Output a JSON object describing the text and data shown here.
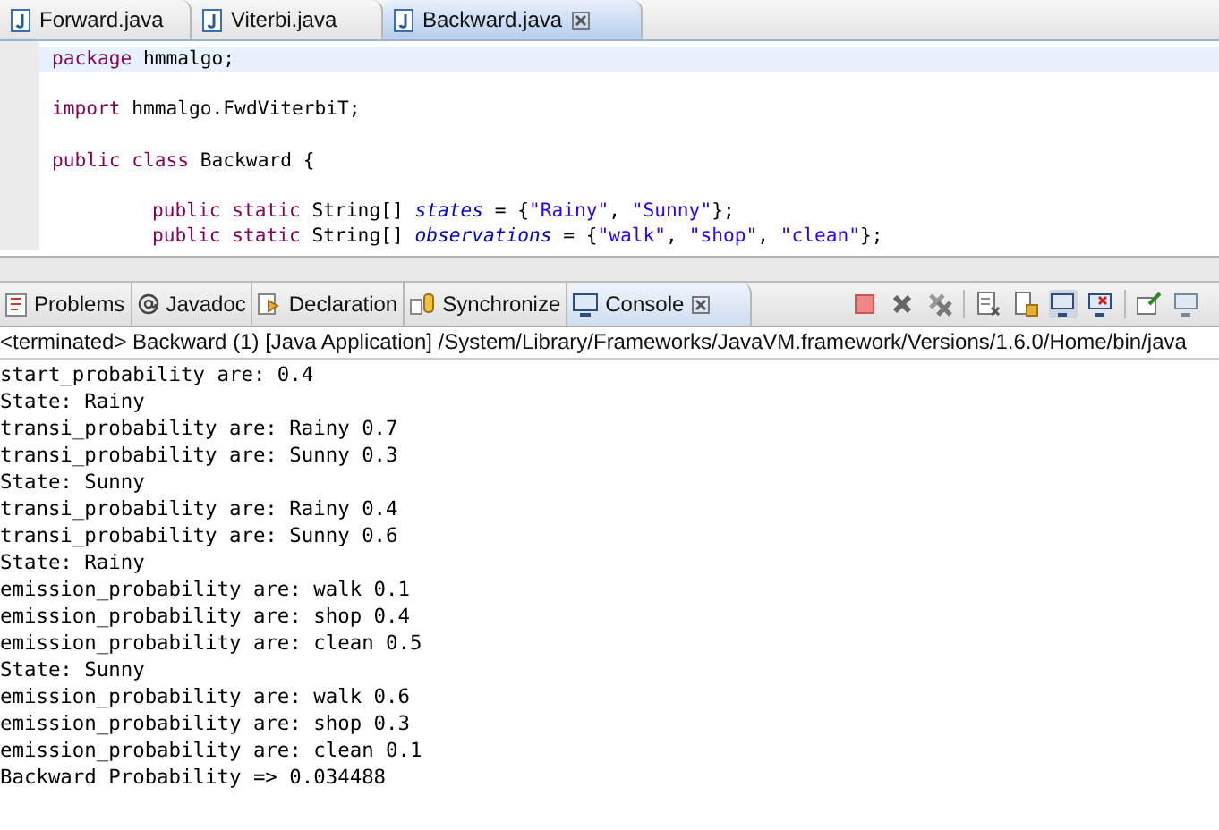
{
  "editor": {
    "tabs": [
      {
        "label": "Forward.java",
        "selected": false
      },
      {
        "label": "Viterbi.java",
        "selected": false
      },
      {
        "label": "Backward.java",
        "selected": true
      }
    ],
    "lines": [
      {
        "kind": "top",
        "tokens": [
          {
            "kind": "keyword",
            "text": "package"
          },
          {
            "kind": "plain",
            "text": " hmmalgo;"
          }
        ]
      },
      {
        "kind": "blank"
      },
      {
        "kind": "top",
        "tokens": [
          {
            "kind": "keyword",
            "text": "import"
          },
          {
            "kind": "plain",
            "text": " hmmalgo.FwdViterbiT;"
          }
        ]
      },
      {
        "kind": "blank"
      },
      {
        "kind": "top",
        "tokens": [
          {
            "kind": "keyword",
            "text": "public class"
          },
          {
            "kind": "plain",
            "text": " Backward {"
          }
        ]
      },
      {
        "kind": "blank"
      },
      {
        "kind": "member",
        "tokens": [
          {
            "kind": "keyword",
            "text": "public static"
          },
          {
            "kind": "plain",
            "text": " String[] "
          },
          {
            "kind": "field",
            "text": "states"
          },
          {
            "kind": "plain",
            "text": " = {"
          },
          {
            "kind": "string",
            "text": "\"Rainy\""
          },
          {
            "kind": "plain",
            "text": ", "
          },
          {
            "kind": "string",
            "text": "\"Sunny\""
          },
          {
            "kind": "plain",
            "text": "};"
          }
        ]
      },
      {
        "kind": "member",
        "tokens": [
          {
            "kind": "keyword",
            "text": "public static"
          },
          {
            "kind": "plain",
            "text": " String[] "
          },
          {
            "kind": "field",
            "text": "observations"
          },
          {
            "kind": "plain",
            "text": " = {"
          },
          {
            "kind": "string",
            "text": "\"walk\""
          },
          {
            "kind": "plain",
            "text": ", "
          },
          {
            "kind": "string",
            "text": "\"shop\""
          },
          {
            "kind": "plain",
            "text": ", "
          },
          {
            "kind": "string",
            "text": "\"clean\""
          },
          {
            "kind": "plain",
            "text": "};"
          }
        ]
      }
    ]
  },
  "views": {
    "tabs": [
      {
        "label": "Problems",
        "selected": false
      },
      {
        "label": "Javadoc",
        "selected": false
      },
      {
        "label": "Declaration",
        "selected": false
      },
      {
        "label": "Synchronize",
        "selected": false
      },
      {
        "label": "Console",
        "selected": true
      }
    ]
  },
  "console": {
    "header": "<terminated> Backward (1) [Java Application] /System/Library/Frameworks/JavaVM.framework/Versions/1.6.0/Home/bin/java",
    "lines": [
      "start_probability are: 0.4",
      "State: Rainy",
      "transi_probability are: Rainy 0.7",
      "transi_probability are: Sunny 0.3",
      "State: Sunny",
      "transi_probability are: Rainy 0.4",
      "transi_probability are: Sunny 0.6",
      "State: Rainy",
      "emission_probability are: walk 0.1",
      "emission_probability are: shop 0.4",
      "emission_probability are: clean 0.5",
      "State: Sunny",
      "emission_probability are: walk 0.6",
      "emission_probability are: shop 0.3",
      "emission_probability are: clean 0.1",
      "Backward Probability => 0.034488"
    ]
  }
}
